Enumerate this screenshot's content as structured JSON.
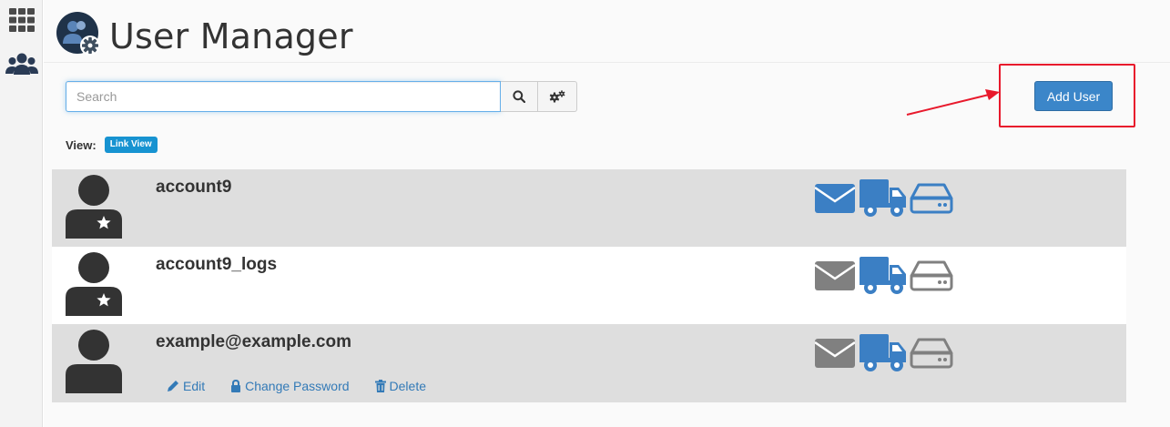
{
  "header": {
    "title": "User Manager"
  },
  "search": {
    "placeholder": "Search",
    "value": ""
  },
  "toolbar": {
    "add_user_label": "Add User"
  },
  "view": {
    "label": "View:",
    "mode": "Link View"
  },
  "colors": {
    "accent": "#3b86c9",
    "badge": "#1793d1",
    "enabled_icon": "#3b7fc4",
    "disabled_icon": "#808080",
    "highlight": "#e8192c"
  },
  "users": [
    {
      "name": "account9",
      "type": "cpanel-account",
      "services": {
        "email": "enabled",
        "ftp": "enabled",
        "webdisk": "enabled"
      }
    },
    {
      "name": "account9_logs",
      "type": "cpanel-account",
      "services": {
        "email": "disabled",
        "ftp": "enabled",
        "webdisk": "disabled"
      }
    },
    {
      "name": "example@example.com",
      "type": "subaccount",
      "services": {
        "email": "disabled",
        "ftp": "enabled",
        "webdisk": "disabled"
      },
      "actions": {
        "edit": "Edit",
        "change_password": "Change Password",
        "delete": "Delete"
      }
    }
  ],
  "icons": [
    "grid-icon",
    "users-icon",
    "user-manager-logo",
    "search-icon",
    "gears-icon",
    "user-avatar-icon",
    "star-icon",
    "envelope-icon",
    "truck-icon",
    "hdd-icon",
    "pencil-icon",
    "lock-icon",
    "trash-icon",
    "arrow-icon"
  ]
}
